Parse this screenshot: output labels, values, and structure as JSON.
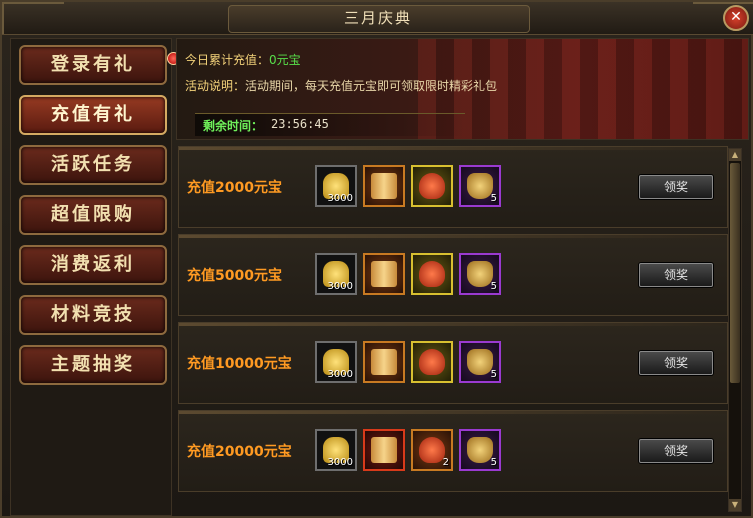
{
  "window": {
    "title": "三月庆典"
  },
  "sidebar": {
    "items": [
      {
        "label": "登录有礼",
        "active": false,
        "badge": true
      },
      {
        "label": "充值有礼",
        "active": true,
        "badge": false
      },
      {
        "label": "活跃任务",
        "active": false,
        "badge": false
      },
      {
        "label": "超值限购",
        "active": false,
        "badge": false
      },
      {
        "label": "消费返利",
        "active": false,
        "badge": false
      },
      {
        "label": "材料竞技",
        "active": false,
        "badge": false
      },
      {
        "label": "主题抽奖",
        "active": false,
        "badge": false
      }
    ]
  },
  "banner": {
    "today_label": "今日累计充值：",
    "today_value": "0元宝",
    "desc_label": "活动说明：",
    "desc_text": "活动期间，每天充值元宝即可领取限时精彩礼包",
    "timer_label": "剩余时间：",
    "timer_value": "23:56:45"
  },
  "rewards": [
    {
      "label": "充值2000元宝",
      "button": "领奖",
      "items": [
        {
          "icon": "gold-ingot-icon",
          "count": "3000",
          "rarity": "gray"
        },
        {
          "icon": "scroll-icon",
          "count": "",
          "rarity": "orange"
        },
        {
          "icon": "gift-bag-icon",
          "count": "",
          "rarity": "yellow"
        },
        {
          "icon": "pouch-icon",
          "count": "5",
          "rarity": "purple"
        }
      ]
    },
    {
      "label": "充值5000元宝",
      "button": "领奖",
      "items": [
        {
          "icon": "gold-ingot-icon",
          "count": "3000",
          "rarity": "gray"
        },
        {
          "icon": "scroll-icon",
          "count": "",
          "rarity": "orange"
        },
        {
          "icon": "gift-bag-icon",
          "count": "",
          "rarity": "yellow"
        },
        {
          "icon": "pouch-icon",
          "count": "5",
          "rarity": "purple"
        }
      ]
    },
    {
      "label": "充值10000元宝",
      "button": "领奖",
      "items": [
        {
          "icon": "gold-ingot-icon",
          "count": "3000",
          "rarity": "gray"
        },
        {
          "icon": "scroll-icon",
          "count": "",
          "rarity": "orange"
        },
        {
          "icon": "gift-bag-icon",
          "count": "",
          "rarity": "yellow"
        },
        {
          "icon": "pouch-icon",
          "count": "5",
          "rarity": "purple"
        }
      ]
    },
    {
      "label": "充值20000元宝",
      "button": "领奖",
      "items": [
        {
          "icon": "gold-ingot-icon",
          "count": "3000",
          "rarity": "gray"
        },
        {
          "icon": "scroll-icon",
          "count": "",
          "rarity": "red"
        },
        {
          "icon": "gift-bag-icon",
          "count": "2",
          "rarity": "orange"
        },
        {
          "icon": "pouch-icon",
          "count": "5",
          "rarity": "purple"
        }
      ]
    }
  ],
  "colors": {
    "accent": "#ff9a22",
    "timer": "#6ff05a",
    "value_green": "#58e04a",
    "label_gold": "#f3d27a"
  }
}
